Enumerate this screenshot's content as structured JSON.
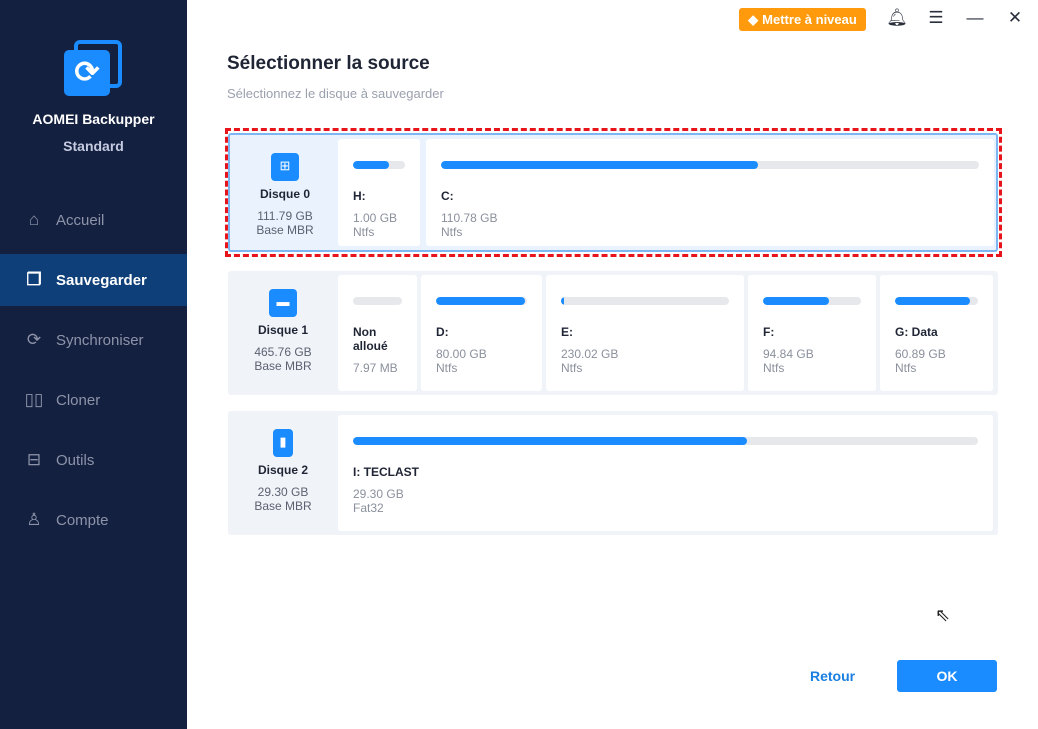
{
  "app": {
    "name": "AOMEI Backupper",
    "edition": "Standard"
  },
  "topbar": {
    "upgrade": "Mettre à niveau"
  },
  "sidebar": {
    "items": [
      {
        "label": "Accueil",
        "icon": "home-icon"
      },
      {
        "label": "Sauvegarder",
        "icon": "backup-icon",
        "active": true
      },
      {
        "label": "Synchroniser",
        "icon": "sync-icon"
      },
      {
        "label": "Cloner",
        "icon": "clone-icon"
      },
      {
        "label": "Outils",
        "icon": "tools-icon"
      },
      {
        "label": "Compte",
        "icon": "user-icon"
      }
    ]
  },
  "main": {
    "title": "Sélectionner la source",
    "subtitle": "Sélectionnez le disque à sauvegarder"
  },
  "disks": [
    {
      "name": "Disque 0",
      "size": "111.79 GB",
      "type": "Base MBR",
      "partitions": [
        {
          "label": "H:",
          "size": "1.00 GB",
          "fs": "Ntfs",
          "used": 0.7
        },
        {
          "label": "C:",
          "size": "110.78 GB",
          "fs": "Ntfs",
          "used": 0.59
        }
      ]
    },
    {
      "name": "Disque 1",
      "size": "465.76 GB",
      "type": "Base MBR",
      "partitions": [
        {
          "label": "Non alloué",
          "size": "7.97 MB",
          "fs": "",
          "used": 0
        },
        {
          "label": "D:",
          "size": "80.00 GB",
          "fs": "Ntfs",
          "used": 0.98
        },
        {
          "label": "E:",
          "size": "230.02 GB",
          "fs": "Ntfs",
          "used": 0.02
        },
        {
          "label": "F:",
          "size": "94.84 GB",
          "fs": "Ntfs",
          "used": 0.67
        },
        {
          "label": "G: Data",
          "size": "60.89 GB",
          "fs": "Ntfs",
          "used": 0.9
        }
      ]
    },
    {
      "name": "Disque 2",
      "size": "29.30 GB",
      "type": "Base MBR",
      "partitions": [
        {
          "label": "I: TECLAST",
          "size": "29.30 GB",
          "fs": "Fat32",
          "used": 0.63
        }
      ]
    }
  ],
  "footer": {
    "back": "Retour",
    "ok": "OK"
  }
}
